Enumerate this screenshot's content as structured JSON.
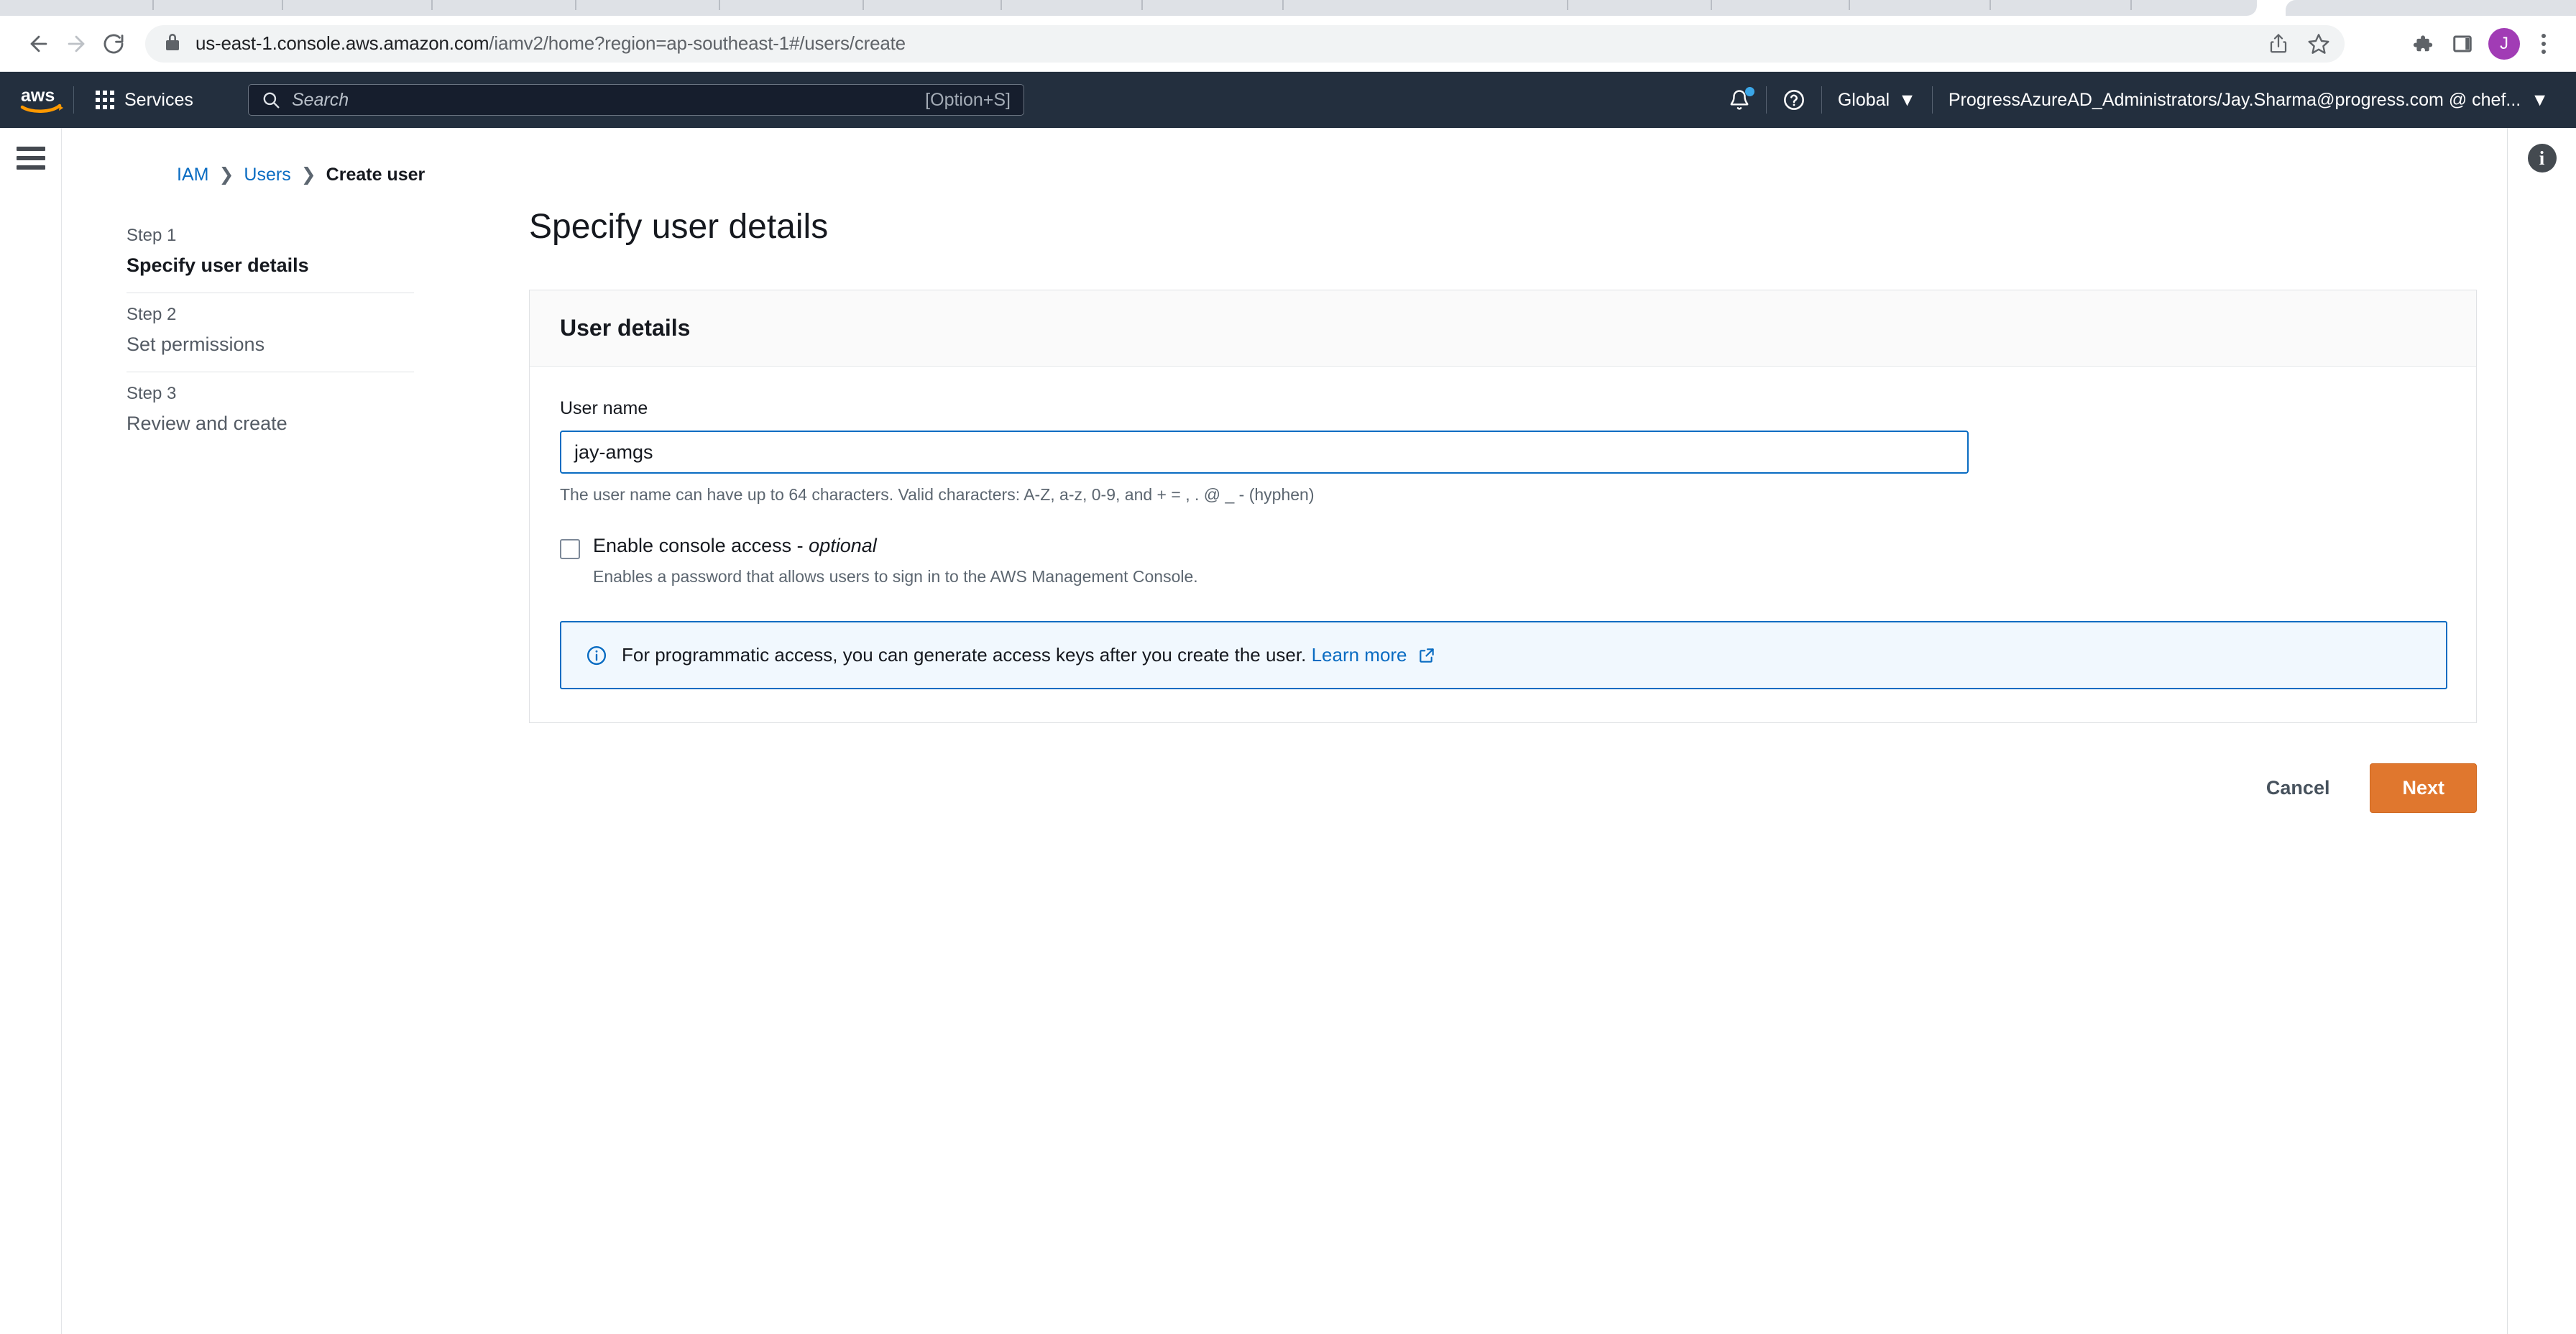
{
  "browser": {
    "url_bold": "us-east-1.console.aws.amazon.com",
    "url_dim": "/iamv2/home?region=ap-southeast-1#/users/create",
    "icons": {
      "back": "back-arrow-icon",
      "forward": "forward-arrow-icon",
      "reload": "reload-icon",
      "lock": "lock-icon",
      "share": "share-icon",
      "bookmark": "star-icon",
      "extensions": "puzzle-piece-icon",
      "sidepanel": "side-panel-icon",
      "menu": "three-dot-menu-icon"
    },
    "profile_initial": "J"
  },
  "aws_nav": {
    "logo": "aws-logo",
    "services_label": "Services",
    "search_placeholder": "Search",
    "search_shortcut": "[Option+S]",
    "notifications_icon": "bell-icon",
    "help_icon": "question-mark-icon",
    "region_label": "Global",
    "region_caret": "▼",
    "account_label": "ProgressAzureAD_Administrators/Jay.Sharma@progress.com @ chef...",
    "account_caret": "▼"
  },
  "breadcrumb": {
    "items": [
      {
        "label": "IAM",
        "link": true
      },
      {
        "label": "Users",
        "link": true
      },
      {
        "label": "Create user",
        "link": false
      }
    ],
    "separator": "❯"
  },
  "wizard": {
    "steps": [
      {
        "num": "Step 1",
        "label": "Specify user details",
        "active": true
      },
      {
        "num": "Step 2",
        "label": "Set permissions",
        "active": false
      },
      {
        "num": "Step 3",
        "label": "Review and create",
        "active": false
      }
    ]
  },
  "page": {
    "title": "Specify user details",
    "card_title": "User details",
    "user_name_label": "User name",
    "user_name_value": "jay-amgs",
    "user_name_helper": "The user name can have up to 64 characters. Valid characters: A-Z, a-z, 0-9, and + = , . @ _ - (hyphen)",
    "console_access_label": "Enable console access - ",
    "console_access_optional": "optional",
    "console_access_desc": "Enables a password that allows users to sign in to the AWS Management Console.",
    "alert_icon": "info-circle-icon",
    "alert_text": "For programmatic access, you can generate access keys after you create the user. ",
    "alert_link": "Learn more",
    "alert_link_icon": "external-link-icon",
    "cancel_label": "Cancel",
    "next_label": "Next"
  },
  "info_panel": {
    "icon": "info-panel-icon",
    "glyph": "i"
  },
  "colors": {
    "aws_navy": "#232f3e",
    "aws_orange": "#e0772e",
    "link_blue": "#0a6cc2",
    "alert_bg": "#f1f8fe",
    "avatar_purple": "#a13cb5"
  }
}
